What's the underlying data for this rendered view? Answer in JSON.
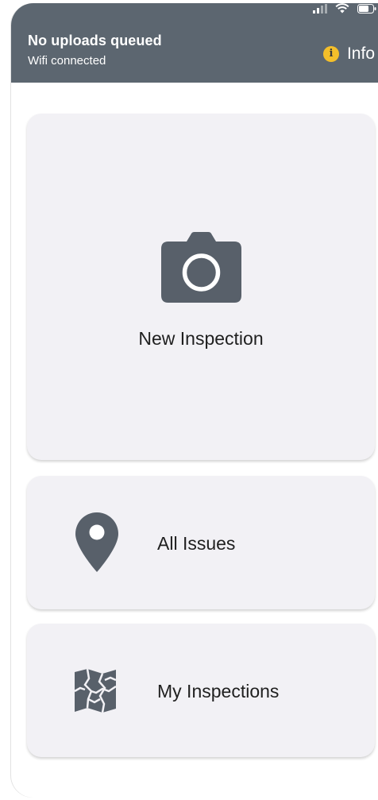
{
  "header": {
    "title": "No uploads queued",
    "subtitle": "Wifi connected",
    "info_label": "Info",
    "background": "#5c6670",
    "info_icon_color": "#f4bf2a"
  },
  "status_bar": {
    "icons": [
      "signal-icon",
      "wifi-icon",
      "battery-icon"
    ]
  },
  "actions": {
    "new_inspection": {
      "label": "New Inspection",
      "icon": "camera-icon"
    },
    "all_issues": {
      "label": "All Issues",
      "icon": "map-pin-icon"
    },
    "my_inspections": {
      "label": "My Inspections",
      "icon": "map-icon"
    }
  },
  "colors": {
    "card_background": "#f2f1f5",
    "icon": "#58606a"
  }
}
